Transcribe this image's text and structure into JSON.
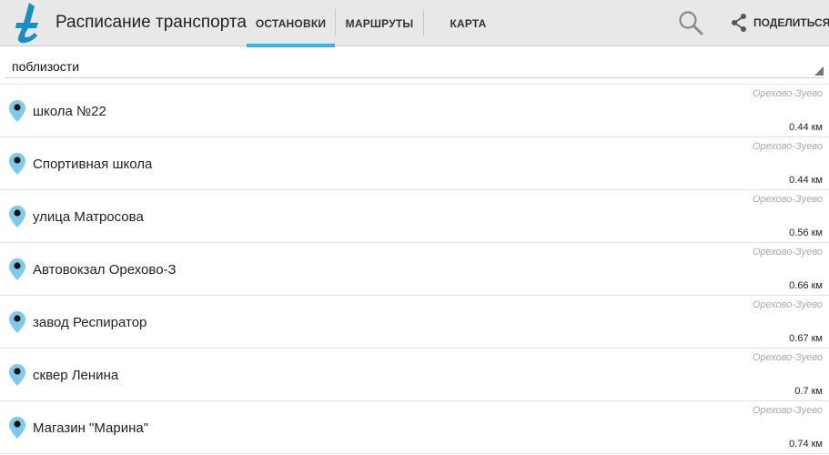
{
  "app": {
    "title": "Расписание транспорта",
    "logo_icon": "t-logo-icon",
    "accent_color": "#33b5e5"
  },
  "tabs": [
    {
      "label": "ОСТАНОВКИ",
      "active": true
    },
    {
      "label": "МАРШРУТЫ",
      "active": false
    },
    {
      "label": "КАРТА",
      "active": false
    }
  ],
  "actions": {
    "search_icon": "search-icon",
    "share_label": "ПОДЕЛИТЬСЯ",
    "share_icon": "share-icon"
  },
  "filter": {
    "value": "поблизости"
  },
  "stops": [
    {
      "name": "школа №22",
      "city": "Орехово-Зуево",
      "distance": "0.44 км"
    },
    {
      "name": "Спортивная школа",
      "city": "Орехово-Зуево",
      "distance": "0.44 км"
    },
    {
      "name": "улица Матросова",
      "city": "Орехово-Зуево",
      "distance": "0.56 км"
    },
    {
      "name": "Автовокзал Орехово-З",
      "city": "Орехово-Зуево",
      "distance": "0.66 км"
    },
    {
      "name": "завод Респиратор",
      "city": "Орехово-Зуево",
      "distance": "0.67 км"
    },
    {
      "name": "сквер Ленина",
      "city": "Орехово-Зуево",
      "distance": "0.7 км"
    },
    {
      "name": "Магазин \"Марина\"",
      "city": "Орехово-Зуево",
      "distance": "0.74 км"
    }
  ]
}
